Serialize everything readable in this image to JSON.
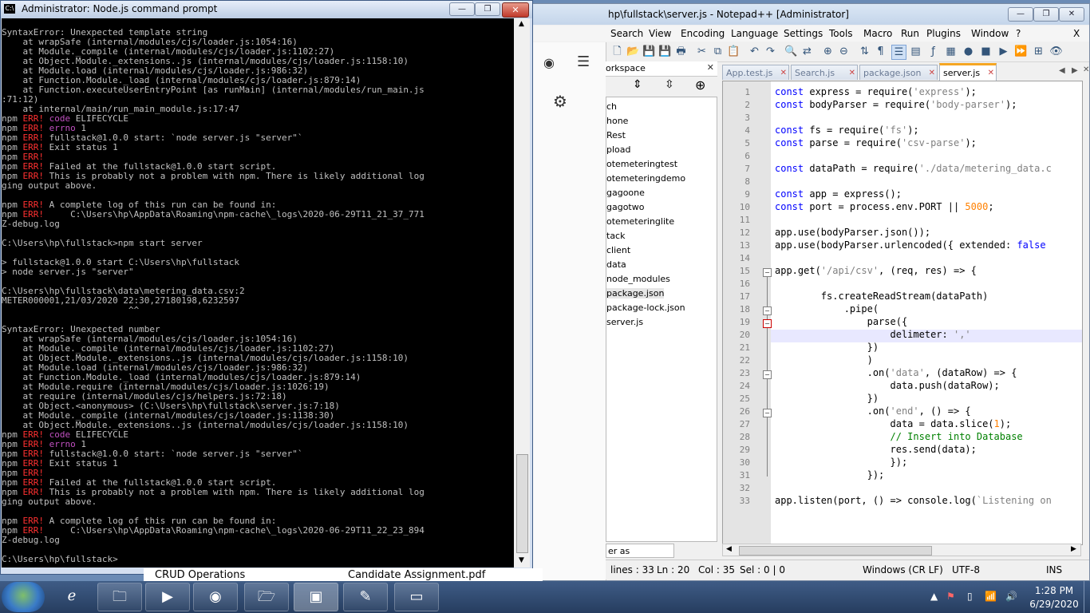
{
  "notepadpp": {
    "title": "hp\\fullstack\\server.js - Notepad++ [Administrator]",
    "menu": [
      "Search",
      "View",
      "Encoding",
      "Language",
      "Settings",
      "Tools",
      "Macro",
      "Run",
      "Plugins",
      "Window",
      "?"
    ],
    "close_x": "X",
    "workspace_title": "orkspace",
    "workspace_tree": [
      "ch",
      "hone",
      "Rest",
      "pload",
      "otemeteringtest",
      "otemeteringdemo",
      "gagoone",
      "gagotwo",
      "otemeteringlite",
      "tack",
      "client",
      "data",
      "node_modules",
      "package.json",
      "package-lock.json",
      "server.js"
    ],
    "workspace_tab": "er as Workspace",
    "tabs": [
      "App.test.js",
      "Search.js",
      "package.json",
      "server.js"
    ],
    "active_tab": "server.js",
    "line_numbers": [
      "1",
      "2",
      "3",
      "4",
      "5",
      "6",
      "7",
      "8",
      "9",
      "10",
      "11",
      "12",
      "13",
      "14",
      "15",
      "16",
      "17",
      "18",
      "19",
      "20",
      "21",
      "22",
      "23",
      "24",
      "25",
      "26",
      "27",
      "28",
      "29",
      "30",
      "31",
      "32",
      "33"
    ],
    "status": {
      "lines": "lines : 33",
      "ln": "Ln : 20",
      "col": "Col : 35",
      "sel": "Sel : 0 | 0",
      "eol": "Windows (CR LF)",
      "encoding": "UTF-8",
      "mode": "INS"
    }
  },
  "cmd": {
    "title": "Administrator: Node.js command prompt",
    "close": "✕",
    "lines": [
      [
        [
          "t",
          "SyntaxError: Unexpected template string"
        ]
      ],
      [
        [
          "t",
          "    at wrapSafe (internal/modules/cjs/loader.js:1054:16)"
        ]
      ],
      [
        [
          "t",
          "    at Module._compile (internal/modules/cjs/loader.js:1102:27)"
        ]
      ],
      [
        [
          "t",
          "    at Object.Module._extensions..js (internal/modules/cjs/loader.js:1158:10)"
        ]
      ],
      [
        [
          "t",
          "    at Module.load (internal/modules/cjs/loader.js:986:32)"
        ]
      ],
      [
        [
          "t",
          "    at Function.Module._load (internal/modules/cjs/loader.js:879:14)"
        ]
      ],
      [
        [
          "t",
          "    at Function.executeUserEntryPoint [as runMain] (internal/modules/run_main.js"
        ]
      ],
      [
        [
          "t",
          ":71:12)"
        ]
      ],
      [
        [
          "t",
          "    at internal/main/run_main_module.js:17:47"
        ]
      ],
      [
        [
          "t",
          "npm "
        ],
        [
          "r",
          "ERR!"
        ],
        [
          "t",
          " "
        ],
        [
          "m",
          "code"
        ],
        [
          "t",
          " ELIFECYCLE"
        ]
      ],
      [
        [
          "t",
          "npm "
        ],
        [
          "r",
          "ERR!"
        ],
        [
          "t",
          " "
        ],
        [
          "m",
          "errno"
        ],
        [
          "t",
          " 1"
        ]
      ],
      [
        [
          "t",
          "npm "
        ],
        [
          "r",
          "ERR!"
        ],
        [
          "t",
          " fullstack@1.0.0 start: `node server.js \"server\"`"
        ]
      ],
      [
        [
          "t",
          "npm "
        ],
        [
          "r",
          "ERR!"
        ],
        [
          "t",
          " Exit status 1"
        ]
      ],
      [
        [
          "t",
          "npm "
        ],
        [
          "r",
          "ERR!"
        ]
      ],
      [
        [
          "t",
          "npm "
        ],
        [
          "r",
          "ERR!"
        ],
        [
          "t",
          " Failed at the fullstack@1.0.0 start script."
        ]
      ],
      [
        [
          "t",
          "npm "
        ],
        [
          "r",
          "ERR!"
        ],
        [
          "t",
          " This is probably not a problem with npm. There is likely additional log"
        ]
      ],
      [
        [
          "t",
          "ging output above."
        ]
      ],
      [
        [
          "t",
          ""
        ]
      ],
      [
        [
          "t",
          "npm "
        ],
        [
          "r",
          "ERR!"
        ],
        [
          "t",
          " A complete log of this run can be found in:"
        ]
      ],
      [
        [
          "t",
          "npm "
        ],
        [
          "r",
          "ERR!"
        ],
        [
          "t",
          "     C:\\Users\\hp\\AppData\\Roaming\\npm-cache\\_logs\\2020-06-29T11_21_37_771"
        ]
      ],
      [
        [
          "t",
          "Z-debug.log"
        ]
      ],
      [
        [
          "t",
          ""
        ]
      ],
      [
        [
          "t",
          "C:\\Users\\hp\\fullstack>npm start server"
        ]
      ],
      [
        [
          "t",
          ""
        ]
      ],
      [
        [
          "t",
          "> fullstack@1.0.0 start C:\\Users\\hp\\fullstack"
        ]
      ],
      [
        [
          "t",
          "> node server.js \"server\""
        ]
      ],
      [
        [
          "t",
          ""
        ]
      ],
      [
        [
          "t",
          "C:\\Users\\hp\\fullstack\\data\\metering_data.csv:2"
        ]
      ],
      [
        [
          "t",
          "METER000001,21/03/2020 22:30,27180198,6232597"
        ]
      ],
      [
        [
          "t",
          "                        ^^"
        ]
      ],
      [
        [
          "t",
          ""
        ]
      ],
      [
        [
          "t",
          "SyntaxError: Unexpected number"
        ]
      ],
      [
        [
          "t",
          "    at wrapSafe (internal/modules/cjs/loader.js:1054:16)"
        ]
      ],
      [
        [
          "t",
          "    at Module._compile (internal/modules/cjs/loader.js:1102:27)"
        ]
      ],
      [
        [
          "t",
          "    at Object.Module._extensions..js (internal/modules/cjs/loader.js:1158:10)"
        ]
      ],
      [
        [
          "t",
          "    at Module.load (internal/modules/cjs/loader.js:986:32)"
        ]
      ],
      [
        [
          "t",
          "    at Function.Module._load (internal/modules/cjs/loader.js:879:14)"
        ]
      ],
      [
        [
          "t",
          "    at Module.require (internal/modules/cjs/loader.js:1026:19)"
        ]
      ],
      [
        [
          "t",
          "    at require (internal/modules/cjs/helpers.js:72:18)"
        ]
      ],
      [
        [
          "t",
          "    at Object.<anonymous> (C:\\Users\\hp\\fullstack\\server.js:7:18)"
        ]
      ],
      [
        [
          "t",
          "    at Module._compile (internal/modules/cjs/loader.js:1138:30)"
        ]
      ],
      [
        [
          "t",
          "    at Object.Module._extensions..js (internal/modules/cjs/loader.js:1158:10)"
        ]
      ],
      [
        [
          "t",
          "npm "
        ],
        [
          "r",
          "ERR!"
        ],
        [
          "t",
          " "
        ],
        [
          "m",
          "code"
        ],
        [
          "t",
          " ELIFECYCLE"
        ]
      ],
      [
        [
          "t",
          "npm "
        ],
        [
          "r",
          "ERR!"
        ],
        [
          "t",
          " "
        ],
        [
          "m",
          "errno"
        ],
        [
          "t",
          " 1"
        ]
      ],
      [
        [
          "t",
          "npm "
        ],
        [
          "r",
          "ERR!"
        ],
        [
          "t",
          " fullstack@1.0.0 start: `node server.js \"server\"`"
        ]
      ],
      [
        [
          "t",
          "npm "
        ],
        [
          "r",
          "ERR!"
        ],
        [
          "t",
          " Exit status 1"
        ]
      ],
      [
        [
          "t",
          "npm "
        ],
        [
          "r",
          "ERR!"
        ]
      ],
      [
        [
          "t",
          "npm "
        ],
        [
          "r",
          "ERR!"
        ],
        [
          "t",
          " Failed at the fullstack@1.0.0 start script."
        ]
      ],
      [
        [
          "t",
          "npm "
        ],
        [
          "r",
          "ERR!"
        ],
        [
          "t",
          " This is probably not a problem with npm. There is likely additional log"
        ]
      ],
      [
        [
          "t",
          "ging output above."
        ]
      ],
      [
        [
          "t",
          ""
        ]
      ],
      [
        [
          "t",
          "npm "
        ],
        [
          "r",
          "ERR!"
        ],
        [
          "t",
          " A complete log of this run can be found in:"
        ]
      ],
      [
        [
          "t",
          "npm "
        ],
        [
          "r",
          "ERR!"
        ],
        [
          "t",
          "     C:\\Users\\hp\\AppData\\Roaming\\npm-cache\\_logs\\2020-06-29T11_22_23_894"
        ]
      ],
      [
        [
          "t",
          "Z-debug.log"
        ]
      ],
      [
        [
          "t",
          ""
        ]
      ],
      [
        [
          "t",
          "C:\\Users\\hp\\fullstack>"
        ]
      ]
    ]
  },
  "code_lines": [
    [
      [
        "k",
        "const"
      ],
      [
        "p",
        " express = require("
      ],
      [
        "s",
        "'express'"
      ],
      [
        "p",
        ");"
      ]
    ],
    [
      [
        "k",
        "const"
      ],
      [
        "p",
        " bodyParser = require("
      ],
      [
        "s",
        "'body-parser'"
      ],
      [
        "p",
        ");"
      ]
    ],
    [],
    [
      [
        "k",
        "const"
      ],
      [
        "p",
        " fs = require("
      ],
      [
        "s",
        "'fs'"
      ],
      [
        "p",
        ");"
      ]
    ],
    [
      [
        "k",
        "const"
      ],
      [
        "p",
        " parse = require("
      ],
      [
        "s",
        "'csv-parse'"
      ],
      [
        "p",
        ");"
      ]
    ],
    [],
    [
      [
        "k",
        "const"
      ],
      [
        "p",
        " dataPath = require("
      ],
      [
        "s",
        "'./data/metering_data.c"
      ]
    ],
    [],
    [
      [
        "k",
        "const"
      ],
      [
        "p",
        " app = express();"
      ]
    ],
    [
      [
        "k",
        "const"
      ],
      [
        "p",
        " port = process.env.PORT || "
      ],
      [
        "n",
        "5000"
      ],
      [
        "p",
        ";"
      ]
    ],
    [],
    [
      [
        "p",
        "app.use(bodyParser.json());"
      ]
    ],
    [
      [
        "p",
        "app.use(bodyParser.urlencoded({ extended: "
      ],
      [
        "k",
        "false"
      ]
    ],
    [],
    [
      [
        "p",
        "app.get("
      ],
      [
        "s",
        "'/api/csv'"
      ],
      [
        "p",
        ", (req, res) => {"
      ]
    ],
    [],
    [
      [
        "p",
        "        fs.createReadStream(dataPath)"
      ]
    ],
    [
      [
        "p",
        "            .pipe("
      ]
    ],
    [
      [
        "p",
        "                parse({"
      ]
    ],
    [
      [
        "p",
        "                    delimeter: "
      ],
      [
        "s",
        "','"
      ]
    ],
    [
      [
        "p",
        "                })"
      ]
    ],
    [
      [
        "p",
        "                )"
      ]
    ],
    [
      [
        "p",
        "                .on("
      ],
      [
        "s",
        "'data'"
      ],
      [
        "p",
        ", (dataRow) => {"
      ]
    ],
    [
      [
        "p",
        "                    data.push(dataRow);"
      ]
    ],
    [
      [
        "p",
        "                })"
      ]
    ],
    [
      [
        "p",
        "                .on("
      ],
      [
        "s",
        "'end'"
      ],
      [
        "p",
        ", () => {"
      ]
    ],
    [
      [
        "p",
        "                    data = data.slice("
      ],
      [
        "n",
        "1"
      ],
      [
        "p",
        ");"
      ]
    ],
    [
      [
        "c",
        "                    // Insert into Database"
      ]
    ],
    [
      [
        "p",
        "                    res.send(data);"
      ]
    ],
    [
      [
        "p",
        "                    });"
      ]
    ],
    [
      [
        "p",
        "                });"
      ]
    ],
    [],
    [
      [
        "p",
        "app.listen(port, () => console.log("
      ],
      [
        "s",
        "`Listening on"
      ]
    ]
  ],
  "taskbar": {
    "bg_windows": [
      "CRUD Operations",
      "Candidate Assignment.pdf"
    ],
    "time": "1:28 PM",
    "date": "6/29/2020"
  }
}
